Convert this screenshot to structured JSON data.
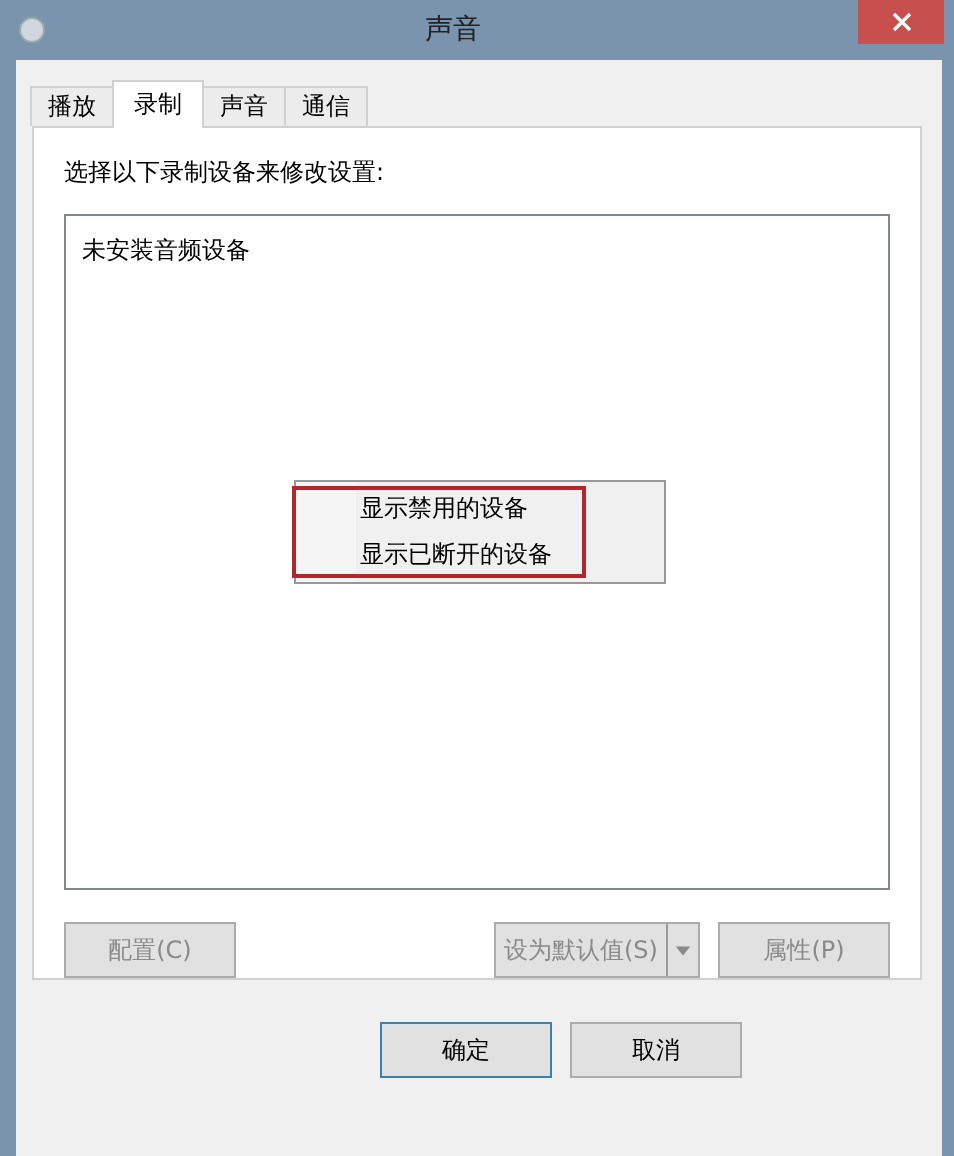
{
  "window": {
    "title": "声音"
  },
  "tabs": [
    {
      "label": "播放",
      "selected": false
    },
    {
      "label": "录制",
      "selected": true
    },
    {
      "label": "声音",
      "selected": false
    },
    {
      "label": "通信",
      "selected": false
    }
  ],
  "instruction": "选择以下录制设备来修改设置:",
  "device_list": {
    "empty_message": "未安装音频设备"
  },
  "context_menu": {
    "items": [
      {
        "label": "显示禁用的设备",
        "checked": false
      },
      {
        "label": "显示已断开的设备",
        "checked": false
      }
    ],
    "highlighted": true
  },
  "device_buttons": [
    {
      "kind": "plain",
      "label": "配置(C)",
      "disabled": true
    },
    {
      "kind": "split",
      "label": "设为默认值(S)",
      "disabled": true
    },
    {
      "kind": "plain",
      "label": "属性(P)",
      "disabled": true
    }
  ],
  "dialog_buttons": [
    {
      "label": "确定",
      "default": true
    },
    {
      "label": "取消",
      "default": false
    }
  ]
}
